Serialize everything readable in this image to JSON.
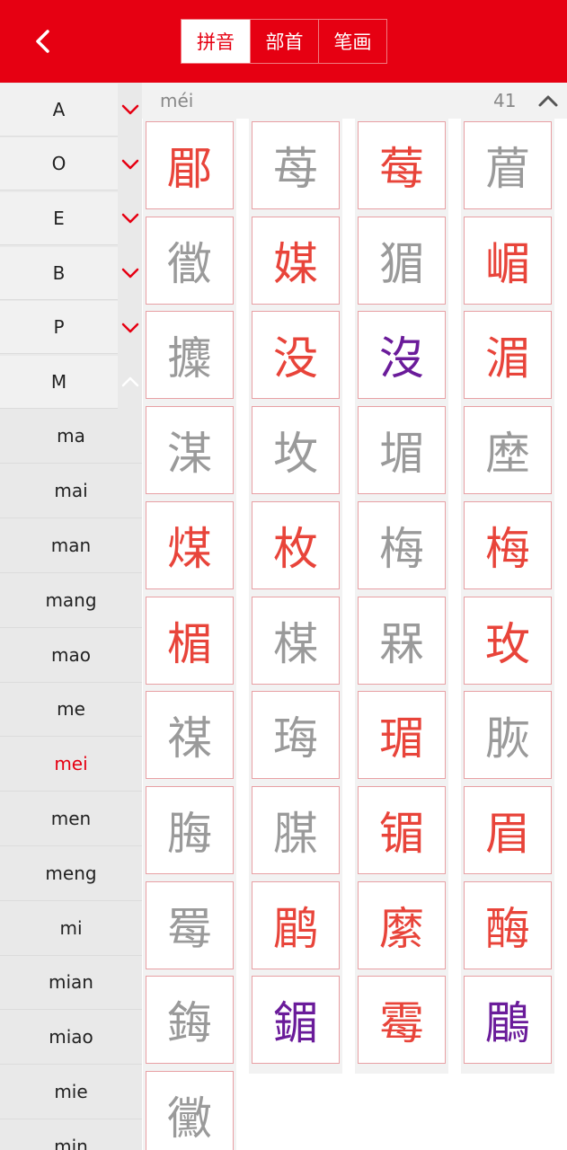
{
  "header": {
    "tabs": [
      {
        "label": "拼音",
        "active": true
      },
      {
        "label": "部首",
        "active": false
      },
      {
        "label": "笔画",
        "active": false
      }
    ]
  },
  "sidebar": {
    "letters": [
      {
        "label": "A",
        "expanded": false
      },
      {
        "label": "O",
        "expanded": false
      },
      {
        "label": "E",
        "expanded": false
      },
      {
        "label": "B",
        "expanded": false
      },
      {
        "label": "P",
        "expanded": false
      },
      {
        "label": "M",
        "expanded": true
      }
    ],
    "pinyin": [
      "ma",
      "mai",
      "man",
      "mang",
      "mao",
      "me",
      "mei",
      "men",
      "meng",
      "mi",
      "mian",
      "miao",
      "mie",
      "min"
    ],
    "selected_pinyin": "mei"
  },
  "content": {
    "pinyin": "méi",
    "count": "41",
    "characters": [
      {
        "char": "郿",
        "color": "red"
      },
      {
        "char": "苺",
        "color": "gray"
      },
      {
        "char": "莓",
        "color": "red"
      },
      {
        "char": "葿",
        "color": "gray"
      },
      {
        "char": "徾",
        "color": "gray"
      },
      {
        "char": "媒",
        "color": "red"
      },
      {
        "char": "猸",
        "color": "gray"
      },
      {
        "char": "嵋",
        "color": "red"
      },
      {
        "char": "攗",
        "color": "gray"
      },
      {
        "char": "没",
        "color": "red"
      },
      {
        "char": "沒",
        "color": "purple"
      },
      {
        "char": "湄",
        "color": "red"
      },
      {
        "char": "湈",
        "color": "gray"
      },
      {
        "char": "坆",
        "color": "gray"
      },
      {
        "char": "堳",
        "color": "gray"
      },
      {
        "char": "塺",
        "color": "gray"
      },
      {
        "char": "煤",
        "color": "red"
      },
      {
        "char": "枚",
        "color": "red"
      },
      {
        "char": "梅",
        "color": "gray"
      },
      {
        "char": "梅",
        "color": "red"
      },
      {
        "char": "楣",
        "color": "red"
      },
      {
        "char": "楳",
        "color": "gray"
      },
      {
        "char": "槑",
        "color": "gray"
      },
      {
        "char": "玫",
        "color": "red"
      },
      {
        "char": "禖",
        "color": "gray"
      },
      {
        "char": "珻",
        "color": "gray"
      },
      {
        "char": "瑂",
        "color": "red"
      },
      {
        "char": "脄",
        "color": "gray"
      },
      {
        "char": "脢",
        "color": "gray"
      },
      {
        "char": "腜",
        "color": "gray"
      },
      {
        "char": "镅",
        "color": "red"
      },
      {
        "char": "眉",
        "color": "red"
      },
      {
        "char": "䍙",
        "color": "gray"
      },
      {
        "char": "鹛",
        "color": "red"
      },
      {
        "char": "縻",
        "color": "red"
      },
      {
        "char": "酶",
        "color": "red"
      },
      {
        "char": "鋂",
        "color": "gray"
      },
      {
        "char": "鎇",
        "color": "purple"
      },
      {
        "char": "霉",
        "color": "red"
      },
      {
        "char": "鶥",
        "color": "purple"
      },
      {
        "char": "黴",
        "color": "gray"
      }
    ]
  },
  "colors": {
    "brand": "#e60012",
    "char_red": "#e8443a",
    "char_gray": "#9a9a9a",
    "char_purple": "#6a1b9a"
  },
  "icons": {
    "back": "chevron-left-icon",
    "letter_collapsed": "chevron-down-icon",
    "letter_expanded": "chevron-up-icon",
    "section_toggle": "chevron-up-icon"
  }
}
